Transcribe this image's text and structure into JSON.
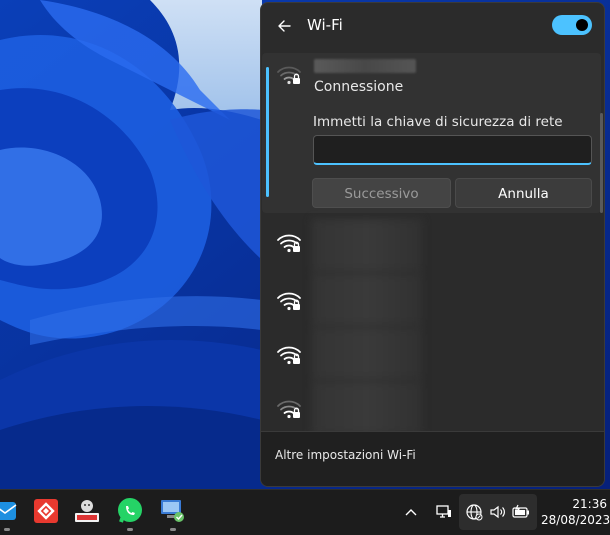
{
  "flyout": {
    "title": "Wi-Fi",
    "wifi_enabled": true,
    "selected_network": {
      "status": "Connessione",
      "key_label": "Immetti la chiave di sicurezza di rete",
      "key_value": "",
      "next_button": "Successivo",
      "cancel_button": "Annulla"
    },
    "other_networks_count": 4,
    "footer_link": "Altre impostazioni Wi-Fi"
  },
  "taskbar": {
    "apps": [
      "mail-icon",
      "anydesk-icon",
      "app-icon",
      "whatsapp-icon",
      "network-setup-icon"
    ],
    "time": "21:36",
    "date": "28/08/2023"
  },
  "colors": {
    "accent": "#4cc2ff",
    "flyout_bg": "#2b2b2b",
    "taskbar_bg": "#1c1c1c"
  }
}
